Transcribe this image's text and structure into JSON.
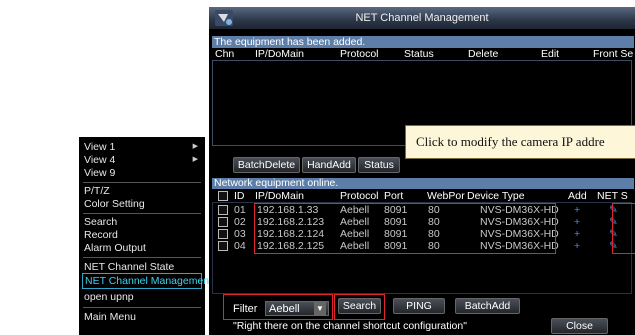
{
  "menu": {
    "items": [
      {
        "label": "View 1",
        "submenu": true
      },
      {
        "label": "View 4",
        "submenu": true
      },
      {
        "label": "View 9",
        "submenu": false
      },
      {
        "label": "P/T/Z",
        "submenu": false
      },
      {
        "label": "Color Setting",
        "submenu": false
      },
      {
        "label": "Search",
        "submenu": false
      },
      {
        "label": "Record",
        "submenu": false
      },
      {
        "label": "Alarm Output",
        "submenu": false
      },
      {
        "label": "NET Channel State",
        "submenu": false
      },
      {
        "label": "NET Channel Management",
        "submenu": false,
        "selected": true
      },
      {
        "label": "open upnp",
        "submenu": false
      },
      {
        "label": "Main Menu",
        "submenu": false
      }
    ],
    "arrow_glyph": "▶"
  },
  "window": {
    "title": "NET Channel Management",
    "added_header": "The equipment has been added.",
    "added_columns": [
      "Chn",
      "IP/DoMain",
      "Protocol",
      "Status",
      "Delete",
      "Edit",
      "Front Se"
    ],
    "buttons": {
      "batch_delete": "BatchDelete",
      "hand_add": "HandAdd",
      "status": "Status"
    },
    "callout": "Click to modify the camera IP addre",
    "online_header": "Network equipment online.",
    "online_columns": [
      "ID",
      "IP/DoMain",
      "Protocol",
      "Port",
      "WebPor",
      "Device Type",
      "Add",
      "NET S"
    ],
    "rows": [
      {
        "id": "01",
        "ip": "192.168.1.33",
        "protocol": "Aebell",
        "port": "8091",
        "webport": "80",
        "device": "NVS-DM36X-HD",
        "add": "+",
        "edit": "✎"
      },
      {
        "id": "02",
        "ip": "192.168.2.123",
        "protocol": "Aebell",
        "port": "8091",
        "webport": "80",
        "device": "NVS-DM36X-HD",
        "add": "+",
        "edit": "✎"
      },
      {
        "id": "03",
        "ip": "192.168.2.124",
        "protocol": "Aebell",
        "port": "8091",
        "webport": "80",
        "device": "NVS-DM36X-HD",
        "add": "+",
        "edit": "✎"
      },
      {
        "id": "04",
        "ip": "192.168.2.125",
        "protocol": "Aebell",
        "port": "8091",
        "webport": "80",
        "device": "NVS-DM36X-HD",
        "add": "+",
        "edit": "✎"
      }
    ],
    "filter_label": "Filter",
    "filter_value": "Aebell",
    "filter_arrow": "▼",
    "bottom_buttons": {
      "search": "Search",
      "ping": "PING",
      "batch_add": "BatchAdd",
      "close": "Close"
    },
    "hint": "\"Right there on the channel shortcut configuration\""
  },
  "colors": {
    "accent_red": "#e0262a",
    "header_blue": "#5d7ea8",
    "menu_highlight": "#2ba5c9"
  }
}
